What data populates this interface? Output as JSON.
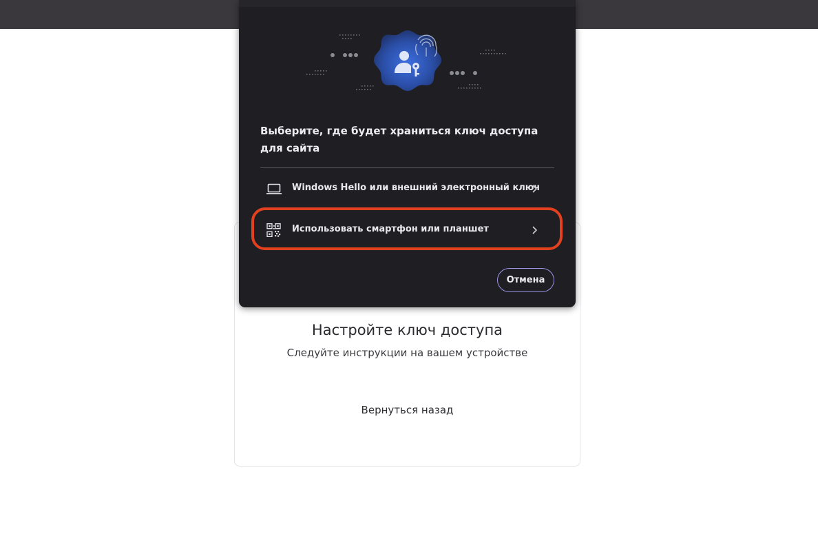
{
  "dialog": {
    "heading": "Выберите, где будет храниться ключ доступа для сайта",
    "options": [
      {
        "label": "Windows Hello или внешний электронный ключ",
        "icon": "laptop-icon"
      },
      {
        "label": "Использовать смартфон или планшет",
        "icon": "qr-code-icon"
      }
    ],
    "cancel_label": "Отмена",
    "highlight_color": "#e2411f",
    "accent_color": "#9b95e6"
  },
  "page": {
    "title": "Настройте ключ доступа",
    "subtitle": "Следуйте инструкции на вашем устройстве",
    "back_label": "Вернуться назад"
  }
}
